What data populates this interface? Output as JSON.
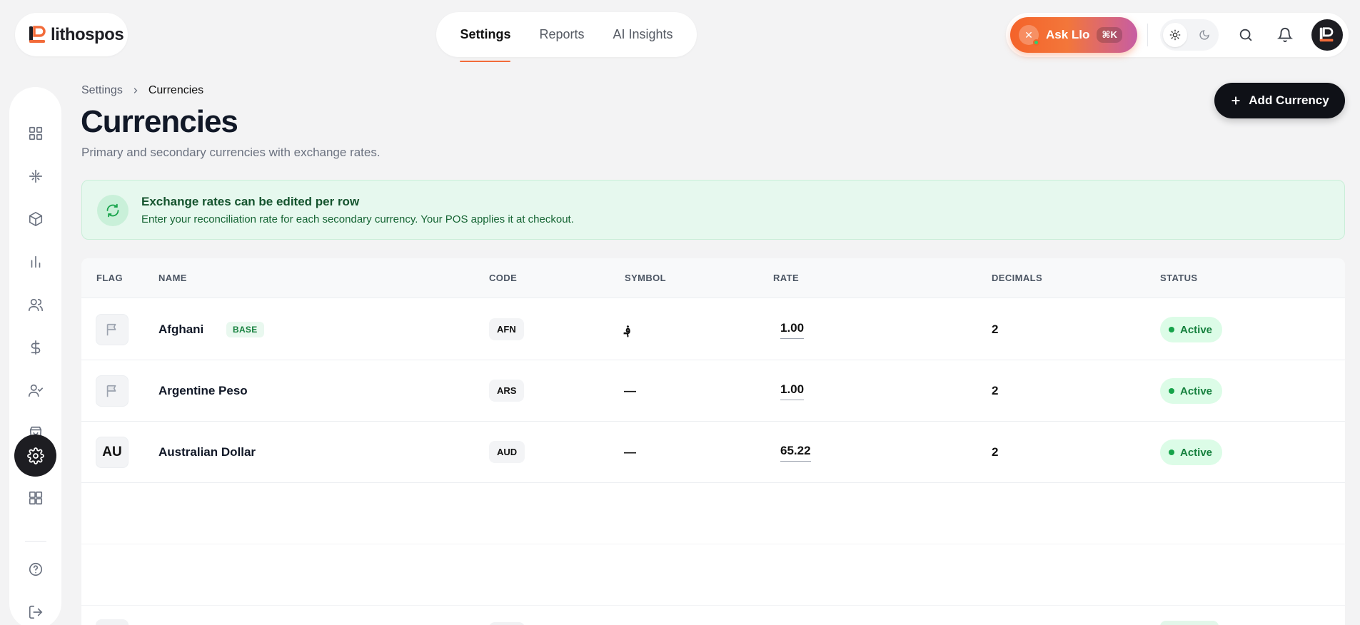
{
  "brand": {
    "name": "lithospos"
  },
  "topnav": {
    "tabs": [
      {
        "label": "Settings",
        "active": true
      },
      {
        "label": "Reports",
        "active": false
      },
      {
        "label": "AI Insights",
        "active": false
      }
    ]
  },
  "topbar": {
    "ask_label": "Ask Llo",
    "ask_shortcut": "⌘K",
    "icons": [
      "sun-icon",
      "moon-icon",
      "search-icon",
      "bell-icon",
      "avatar"
    ]
  },
  "sidebar": {
    "items": [
      {
        "icon": "dashboard-icon",
        "active": false
      },
      {
        "icon": "pos-icon",
        "active": false
      },
      {
        "icon": "box-icon",
        "active": false
      },
      {
        "icon": "chart-icon",
        "active": false
      },
      {
        "icon": "users-icon",
        "active": false
      },
      {
        "icon": "dollar-icon",
        "active": false
      },
      {
        "icon": "user-check-icon",
        "active": false
      },
      {
        "icon": "shopping-bag-icon",
        "active": false
      },
      {
        "icon": "gear-icon",
        "active": true
      },
      {
        "icon": "apps-icon",
        "active": false
      }
    ],
    "footer": [
      "help-icon",
      "logout-icon"
    ]
  },
  "breadcrumb": {
    "parent": "Settings",
    "current": "Currencies"
  },
  "page": {
    "title": "Currencies",
    "subtitle": "Primary and secondary currencies with exchange rates.",
    "add_button": "Add Currency"
  },
  "banner": {
    "title": "Exchange rates can be edited per row",
    "text": "Enter your reconciliation rate for each secondary currency. Your POS applies it at checkout."
  },
  "table": {
    "headers": [
      "FLAG",
      "NAME",
      "CODE",
      "SYMBOL",
      "RATE",
      "DECIMALS",
      "STATUS"
    ],
    "rows": [
      {
        "flag": "",
        "name": "Afghani",
        "badge": "BASE",
        "code": "AFN",
        "symbol": "؋",
        "rate": "1.00",
        "decimals": "2",
        "status": "Active"
      },
      {
        "flag": "",
        "name": "Argentine Peso",
        "badge": "",
        "code": "ARS",
        "symbol": "—",
        "rate": "1.00",
        "decimals": "2",
        "status": "Active"
      },
      {
        "flag": "AU",
        "name": "Australian Dollar",
        "badge": "",
        "code": "AUD",
        "symbol": "—",
        "rate": "65.22",
        "decimals": "2",
        "status": "Active"
      }
    ]
  },
  "colors": {
    "accent": "#f26b3a",
    "dark": "#0f1117",
    "success": "#16a34a",
    "banner_bg": "#e6f8ee"
  }
}
